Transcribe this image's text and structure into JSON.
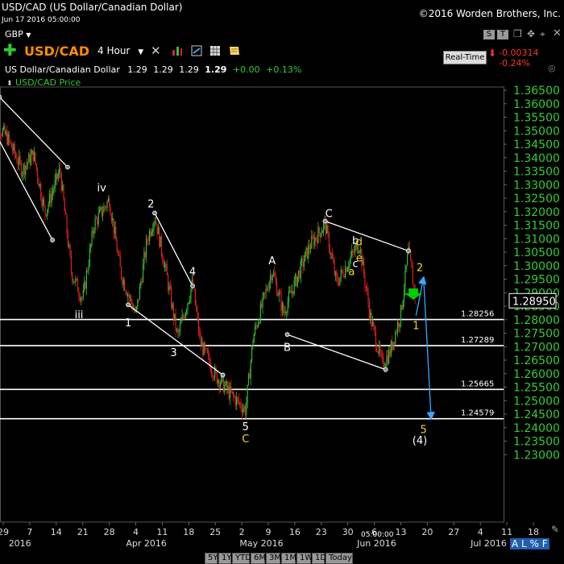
{
  "header": {
    "instrument": "USD/CAD (US Dollar/Canadian Dollar)",
    "datetime": "Jun 17 2016 05:00:00",
    "copyright": "©2016 Worden Brothers, Inc.",
    "currency": "GBP",
    "symbol": "USD/CAD",
    "timeframe": "4 Hour",
    "name": "US Dollar/Canadian Dollar",
    "open": "1.29",
    "high": "1.29",
    "low": "1.29",
    "close": "1.29",
    "change": "+0.00",
    "change_pct": "+0.13%",
    "series_label": "USD/CAD Price",
    "realtime_label": "Real-Time",
    "rt_change": "-0.00314",
    "rt_change_pct": "-0.24%",
    "s_btn": "S",
    "t_btn": "T"
  },
  "footer": {
    "time_label": "05:00:00",
    "bottom_left": "A L % F",
    "timeframes": [
      "5Y",
      "1Y",
      "YTD",
      "6M",
      "3M",
      "1M",
      "1W",
      "1D",
      "Today"
    ]
  },
  "colors": {
    "bull": "#2fbf2f",
    "bear": "#e02020",
    "price_axis": "#33cc33",
    "wave_white": "#ffffff",
    "wave_yellow": "#ffd21f",
    "projection": "#33aaff",
    "arrow_green": "#00cc00",
    "realtime_red": "#ff3333"
  },
  "chart_data": {
    "type": "candlestick",
    "title": "USD/CAD Price",
    "ylim": [
      1.225,
      1.37
    ],
    "y_ticks": [
      "1.36500",
      "1.36000",
      "1.35500",
      "1.35000",
      "1.34500",
      "1.34000",
      "1.33500",
      "1.33000",
      "1.32500",
      "1.32000",
      "1.31500",
      "1.31000",
      "1.30500",
      "1.30000",
      "1.29500",
      "1.29000",
      "1.28500",
      "1.28000",
      "1.27500",
      "1.27000",
      "1.26500",
      "1.26000",
      "1.25500",
      "1.25000",
      "1.24500",
      "1.24000",
      "1.23500",
      "1.23000"
    ],
    "x_ticks": [
      {
        "label": "29",
        "date": "2016-02-29"
      },
      {
        "label": "7",
        "date": "2016-03-07"
      },
      {
        "label": "14",
        "date": "2016-03-14"
      },
      {
        "label": "21",
        "date": "2016-03-21"
      },
      {
        "label": "28",
        "date": "2016-03-28"
      },
      {
        "label": "4",
        "date": "2016-04-04"
      },
      {
        "label": "11",
        "date": "2016-04-11"
      },
      {
        "label": "18",
        "date": "2016-04-18"
      },
      {
        "label": "25",
        "date": "2016-04-25"
      },
      {
        "label": "2",
        "date": "2016-05-02"
      },
      {
        "label": "9",
        "date": "2016-05-09"
      },
      {
        "label": "16",
        "date": "2016-05-16"
      },
      {
        "label": "23",
        "date": "2016-05-23"
      },
      {
        "label": "30",
        "date": "2016-05-30"
      },
      {
        "label": "6",
        "date": "2016-06-06"
      },
      {
        "label": "13",
        "date": "2016-06-13"
      },
      {
        "label": "20",
        "date": "2016-06-20"
      },
      {
        "label": "27",
        "date": "2016-06-27"
      },
      {
        "label": "4",
        "date": "2016-07-04"
      },
      {
        "label": "11",
        "date": "2016-07-11"
      },
      {
        "label": "18",
        "date": "2016-07-18"
      }
    ],
    "month_labels": [
      {
        "label": "2016",
        "date": "2016-03-01"
      },
      {
        "label": "Apr 2016",
        "date": "2016-04-01"
      },
      {
        "label": "May 2016",
        "date": "2016-05-01"
      },
      {
        "label": "Jun 2016",
        "date": "2016-06-01"
      },
      {
        "label": "Jul 2016",
        "date": "2016-07-01"
      }
    ],
    "last_price": "1.28950",
    "horizontal_levels": [
      {
        "value": 1.28256,
        "label": "1.28256"
      },
      {
        "value": 1.27289,
        "label": "1.27289"
      },
      {
        "value": 1.25665,
        "label": "1.25665"
      },
      {
        "value": 1.24579,
        "label": "1.24579"
      }
    ],
    "price_path": [
      {
        "date": "2016-02-26",
        "price": 1.357
      },
      {
        "date": "2016-03-01",
        "price": 1.35
      },
      {
        "date": "2016-03-05",
        "price": 1.338
      },
      {
        "date": "2016-03-08",
        "price": 1.344
      },
      {
        "date": "2016-03-11",
        "price": 1.322
      },
      {
        "date": "2016-03-15",
        "price": 1.338
      },
      {
        "date": "2016-03-18",
        "price": 1.3
      },
      {
        "date": "2016-03-21",
        "price": 1.29
      },
      {
        "date": "2016-03-24",
        "price": 1.318
      },
      {
        "date": "2016-03-28",
        "price": 1.327
      },
      {
        "date": "2016-03-31",
        "price": 1.3
      },
      {
        "date": "2016-04-04",
        "price": 1.284
      },
      {
        "date": "2016-04-07",
        "price": 1.312
      },
      {
        "date": "2016-04-09",
        "price": 1.321
      },
      {
        "date": "2016-04-12",
        "price": 1.3
      },
      {
        "date": "2016-04-15",
        "price": 1.276
      },
      {
        "date": "2016-04-19",
        "price": 1.296
      },
      {
        "date": "2016-04-21",
        "price": 1.274
      },
      {
        "date": "2016-04-25",
        "price": 1.262
      },
      {
        "date": "2016-04-29",
        "price": 1.255
      },
      {
        "date": "2016-05-03",
        "price": 1.249
      },
      {
        "date": "2016-05-05",
        "price": 1.276
      },
      {
        "date": "2016-05-10",
        "price": 1.301
      },
      {
        "date": "2016-05-13",
        "price": 1.285
      },
      {
        "date": "2016-05-16",
        "price": 1.296
      },
      {
        "date": "2016-05-20",
        "price": 1.31
      },
      {
        "date": "2016-05-24",
        "price": 1.318
      },
      {
        "date": "2016-05-27",
        "price": 1.296
      },
      {
        "date": "2016-05-31",
        "price": 1.306
      },
      {
        "date": "2016-06-02",
        "price": 1.311
      },
      {
        "date": "2016-06-05",
        "price": 1.283
      },
      {
        "date": "2016-06-08",
        "price": 1.266
      },
      {
        "date": "2016-06-10",
        "price": 1.27
      },
      {
        "date": "2016-06-13",
        "price": 1.285
      },
      {
        "date": "2016-06-15",
        "price": 1.308
      },
      {
        "date": "2016-06-17",
        "price": 1.2895
      }
    ],
    "trendlines": [
      {
        "from": {
          "date": "2016-02-28",
          "price": 1.365
        },
        "to": {
          "date": "2016-03-17",
          "price": 1.339
        }
      },
      {
        "from": {
          "date": "2016-02-26",
          "price": 1.354
        },
        "to": {
          "date": "2016-03-13",
          "price": 1.312
        }
      },
      {
        "from": {
          "date": "2016-04-09",
          "price": 1.322
        },
        "to": {
          "date": "2016-04-19",
          "price": 1.295
        }
      },
      {
        "from": {
          "date": "2016-04-02",
          "price": 1.288
        },
        "to": {
          "date": "2016-04-27",
          "price": 1.262
        }
      },
      {
        "from": {
          "date": "2016-05-24",
          "price": 1.319
        },
        "to": {
          "date": "2016-06-15",
          "price": 1.308
        }
      },
      {
        "from": {
          "date": "2016-05-14",
          "price": 1.277
        },
        "to": {
          "date": "2016-06-09",
          "price": 1.264
        }
      }
    ],
    "projections": [
      {
        "from": {
          "date": "2016-06-17",
          "price": 1.284
        },
        "to": {
          "date": "2016-06-19",
          "price": 1.298
        }
      },
      {
        "from": {
          "date": "2016-06-19",
          "price": 1.298
        },
        "to": {
          "date": "2016-06-21",
          "price": 1.246
        }
      }
    ],
    "wave_labels": [
      {
        "text": "iv",
        "date": "2016-03-26",
        "price": 1.33,
        "color": "white"
      },
      {
        "text": "iii",
        "date": "2016-03-20",
        "price": 1.283,
        "color": "white"
      },
      {
        "text": "2",
        "date": "2016-04-08",
        "price": 1.324,
        "color": "white"
      },
      {
        "text": "1",
        "date": "2016-04-02",
        "price": 1.28,
        "color": "white"
      },
      {
        "text": "4",
        "date": "2016-04-19",
        "price": 1.299,
        "color": "white"
      },
      {
        "text": "3",
        "date": "2016-04-14",
        "price": 1.269,
        "color": "white"
      },
      {
        "text": "5",
        "date": "2016-05-03",
        "price": 1.2415,
        "color": "white"
      },
      {
        "text": "C",
        "date": "2016-05-03",
        "price": 1.237,
        "color": "yellow"
      },
      {
        "text": "A",
        "date": "2016-05-10",
        "price": 1.303,
        "color": "white"
      },
      {
        "text": "B",
        "date": "2016-05-14",
        "price": 1.271,
        "color": "white"
      },
      {
        "text": "C",
        "date": "2016-05-25",
        "price": 1.3205,
        "color": "white"
      },
      {
        "text": "b",
        "date": "2016-06-01",
        "price": 1.3105,
        "color": "white"
      },
      {
        "text": "d",
        "date": "2016-06-02",
        "price": 1.31,
        "color": "yellow"
      },
      {
        "text": "c",
        "date": "2016-06-01",
        "price": 1.302,
        "color": "white"
      },
      {
        "text": "e",
        "date": "2016-06-02",
        "price": 1.304,
        "color": "yellow"
      },
      {
        "text": "a",
        "date": "2016-05-31",
        "price": 1.299,
        "color": "yellow"
      },
      {
        "text": "2",
        "date": "2016-06-18",
        "price": 1.3005,
        "color": "yellow"
      },
      {
        "text": "1",
        "date": "2016-06-17",
        "price": 1.279,
        "color": "yellow"
      },
      {
        "text": "5",
        "date": "2016-06-19",
        "price": 1.2405,
        "color": "yellow"
      },
      {
        "text": "(4)",
        "date": "2016-06-18",
        "price": 1.2365,
        "color": "white"
      }
    ]
  }
}
